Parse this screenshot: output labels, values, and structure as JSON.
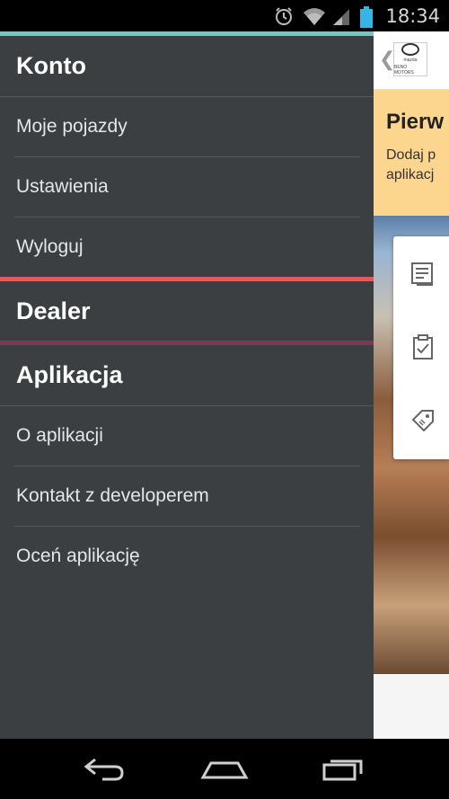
{
  "status_bar": {
    "time": "18:34",
    "icons": [
      "alarm-icon",
      "wifi-icon",
      "cell-signal-icon",
      "battery-icon"
    ]
  },
  "drawer": {
    "stripe_colors": {
      "konto": "#6fc6c3",
      "dealer": "#e05a5a",
      "aplikacja": "#7a3a55"
    },
    "sections": {
      "konto": {
        "title": "Konto",
        "items": [
          "Moje pojazdy",
          "Ustawienia",
          "Wyloguj"
        ]
      },
      "dealer": {
        "title": "Dealer"
      },
      "aplikacja": {
        "title": "Aplikacja",
        "items": [
          "O aplikacji",
          "Kontakt z developerem",
          "Oceń aplikację"
        ]
      }
    }
  },
  "background_app": {
    "back_icon": "chevron-left-icon",
    "logo_text": "mazda",
    "logo_subtext": "BENO MOTORS",
    "promo_title": "Pierw",
    "promo_line1": "Dodaj p",
    "promo_line2": "aplikacj",
    "card_icons": [
      "document-icon",
      "clipboard-check-icon",
      "tag-icon"
    ]
  },
  "nav_bar": {
    "icons": [
      "back-icon",
      "home-icon",
      "recent-apps-icon"
    ]
  }
}
